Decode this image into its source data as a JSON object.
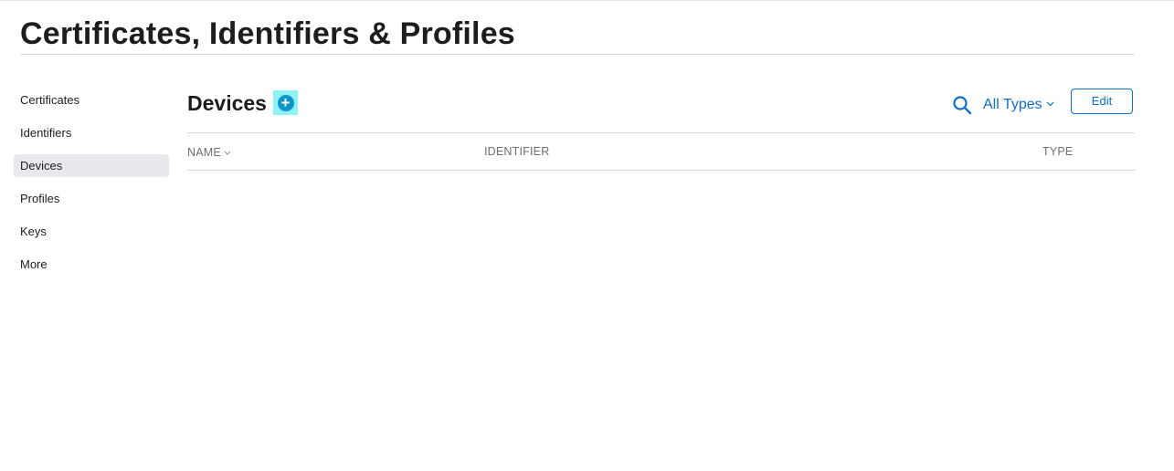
{
  "page": {
    "title": "Certificates, Identifiers & Profiles"
  },
  "sidebar": {
    "items": [
      {
        "label": "Certificates",
        "active": false
      },
      {
        "label": "Identifiers",
        "active": false
      },
      {
        "label": "Devices",
        "active": true
      },
      {
        "label": "Profiles",
        "active": false
      },
      {
        "label": "Keys",
        "active": false
      },
      {
        "label": "More",
        "active": false
      }
    ]
  },
  "main": {
    "title": "Devices",
    "add_icon": "plus-circle-icon",
    "search_icon": "search-icon",
    "filter": {
      "label": "All Types",
      "icon": "chevron-down-icon"
    },
    "edit_label": "Edit",
    "table": {
      "columns": [
        "NAME",
        "IDENTIFIER",
        "TYPE"
      ],
      "sort_icon": "chevron-down-icon",
      "rows": []
    }
  },
  "colors": {
    "accent": "#0f6fc6",
    "add_button_bg": "#8ef2f8",
    "add_circle": "#0e96c8",
    "active_item_bg": "#e8e8ed",
    "divider": "#d8d8d8"
  }
}
